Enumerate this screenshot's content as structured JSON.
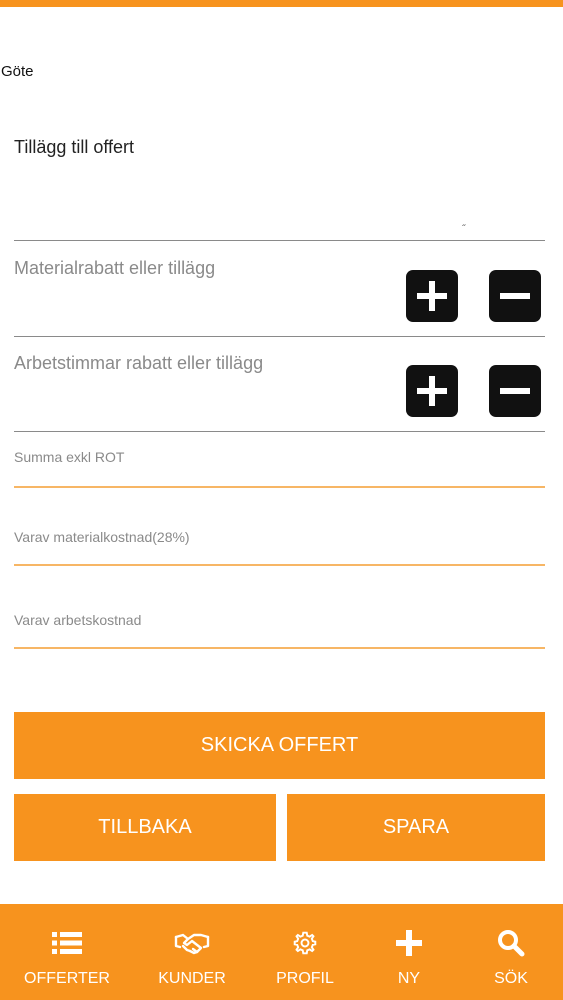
{
  "customer": {
    "name": "Göte"
  },
  "form": {
    "addition_label": "Tillägg till offert",
    "resize_mark": "˝",
    "material_label": "Materialrabatt eller tillägg",
    "labor_label": "Arbetstimmar rabatt eller tillägg",
    "sum_label": "Summa exkl ROT",
    "material_cost_label": "Varav materialkostnad(28%)",
    "labor_cost_label": "Varav arbetskostnad"
  },
  "actions": {
    "send_label": "SKICKA OFFERT",
    "back_label": "TILLBAKA",
    "save_label": "SPARA"
  },
  "colors": {
    "accent": "#f7931e",
    "button_dark": "#111111"
  },
  "bottom_nav": {
    "items": [
      {
        "label": "OFFERTER",
        "icon": "list-icon"
      },
      {
        "label": "KUNDER",
        "icon": "handshake-icon"
      },
      {
        "label": "PROFIL",
        "icon": "gear-icon"
      },
      {
        "label": "NY",
        "icon": "plus-icon"
      },
      {
        "label": "SÖK",
        "icon": "search-icon"
      }
    ]
  }
}
